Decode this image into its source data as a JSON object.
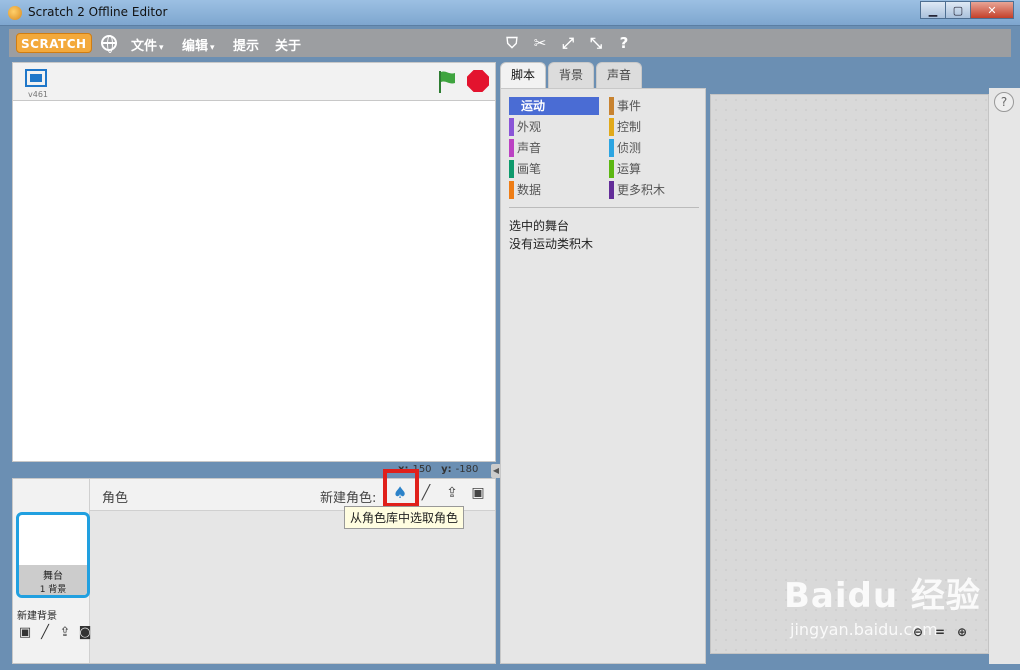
{
  "window": {
    "title": "Scratch 2 Offline Editor",
    "minimize": "▁",
    "maximize": "▢",
    "close": "✕"
  },
  "menubar": {
    "logo": "SCRATCH",
    "menus": [
      {
        "label": "文件",
        "arrow": "▾"
      },
      {
        "label": "编辑",
        "arrow": "▾"
      },
      {
        "label": "提示"
      },
      {
        "label": "关于"
      }
    ],
    "tools": [
      "stamp-icon",
      "cut-icon",
      "grow-icon",
      "shrink-icon",
      "help-icon"
    ],
    "tool_glyphs": [
      "⛉",
      "✂",
      "⤢",
      "⤡",
      "?"
    ]
  },
  "stage": {
    "version": "v461",
    "coords": {
      "x_label": "x:",
      "x_value": "150",
      "y_label": "y:",
      "y_value": "-180"
    }
  },
  "sprites": {
    "title": "角色",
    "new_sprite_label": "新建角色:",
    "tool_glyphs": [
      "♠",
      "╱",
      "⇪",
      "▣"
    ],
    "tooltip": "从角色库中选取角色",
    "stage_thumb": {
      "label": "舞台",
      "sublabel": "1 背景"
    },
    "new_backdrop_label": "新建背景",
    "backdrop_tool_glyphs": [
      "▣",
      "╱",
      "⇪",
      "◙"
    ]
  },
  "tabs": [
    "脚本",
    "背景",
    "声音"
  ],
  "palette": {
    "categories": [
      {
        "label": "运动",
        "color": "#4a6cd4",
        "active": true
      },
      {
        "label": "事件",
        "color": "#c88330"
      },
      {
        "label": "外观",
        "color": "#8a55d7"
      },
      {
        "label": "控制",
        "color": "#e1a91a"
      },
      {
        "label": "声音",
        "color": "#bb42c3"
      },
      {
        "label": "侦测",
        "color": "#2ca5e2"
      },
      {
        "label": "画笔",
        "color": "#0e9a6c"
      },
      {
        "label": "运算",
        "color": "#5cb712"
      },
      {
        "label": "数据",
        "color": "#ee7d16"
      },
      {
        "label": "更多积木",
        "color": "#632d99"
      }
    ],
    "msg1": "选中的舞台",
    "msg2": "没有运动类积木"
  },
  "scripts": {
    "help": "?",
    "zoom": [
      "🔍-",
      "=",
      "🔍+"
    ],
    "zoom_glyphs": [
      "⊖",
      "=",
      "⊕"
    ]
  },
  "watermark": {
    "main": "Baidu 经验",
    "sub": "jingyan.baidu.com"
  }
}
